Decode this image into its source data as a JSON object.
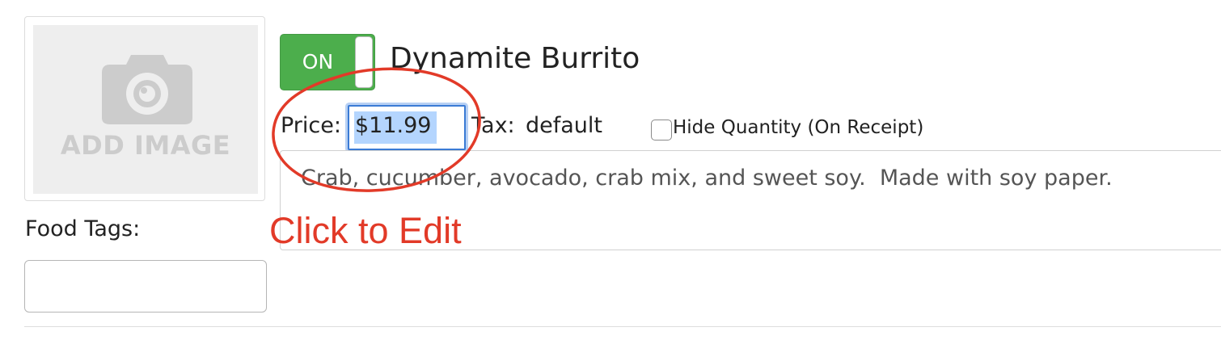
{
  "image_placeholder": {
    "label": "ADD IMAGE",
    "icon": "camera-icon"
  },
  "food_tags": {
    "label": "Food Tags:",
    "value": "",
    "placeholder": ""
  },
  "item": {
    "toggle_label": "ON",
    "toggle_state": "on",
    "name": "Dynamite Burrito",
    "price_label": "Price:",
    "price_value": "$11.99",
    "tax_label": "Tax:",
    "tax_value": "default",
    "hide_quantity_label": "Hide Quantity (On Receipt)",
    "hide_quantity_checked": false,
    "description": "Crab, cucumber, avocado, crab mix, and sweet soy.  Made with soy paper."
  },
  "annotation": {
    "text": "Click to Edit",
    "color": "#e23a28"
  },
  "colors": {
    "toggle_on": "#4cae4c",
    "focus_ring": "#3a7bd5",
    "selection": "#b4d5fe"
  }
}
